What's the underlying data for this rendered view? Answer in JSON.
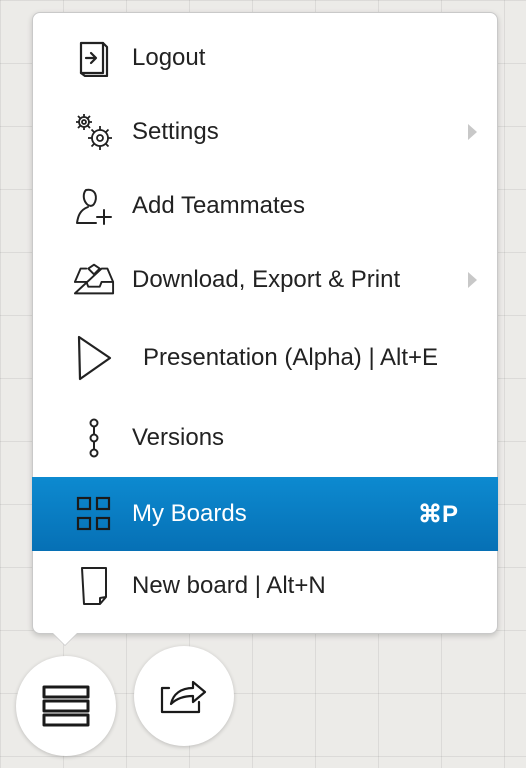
{
  "menu": {
    "items": [
      {
        "label": "Logout",
        "icon": "logout-icon"
      },
      {
        "label": "Settings",
        "icon": "settings-gears-icon",
        "has_submenu": true
      },
      {
        "label": "Add Teammates",
        "icon": "add-user-icon"
      },
      {
        "label": "Download, Export & Print",
        "icon": "download-tray-icon",
        "has_submenu": true
      },
      {
        "label": "Presentation (Alpha) | Alt+E",
        "icon": "play-icon"
      },
      {
        "label": "Versions",
        "icon": "versions-icon"
      },
      {
        "label": "My Boards",
        "icon": "grid-icon",
        "shortcut": "⌘P",
        "active": true
      },
      {
        "label": "New board | Alt+N",
        "icon": "new-page-icon"
      }
    ]
  },
  "fab_buttons": [
    {
      "icon": "menu-stack-icon"
    },
    {
      "icon": "share-export-icon"
    }
  ],
  "colors": {
    "active_bg": "#0a7cc4",
    "canvas_bg": "#ecebe8",
    "text": "#222222"
  }
}
